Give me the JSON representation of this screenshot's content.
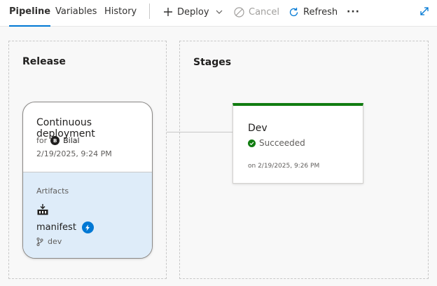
{
  "tabs": [
    {
      "label": "Pipeline",
      "active": true
    },
    {
      "label": "Variables",
      "active": false
    },
    {
      "label": "History",
      "active": false
    }
  ],
  "toolbar": {
    "deploy_label": "Deploy",
    "cancel_label": "Cancel",
    "refresh_label": "Refresh",
    "more_label": "···"
  },
  "release": {
    "section_title": "Release",
    "card_title": "Continuous deployment",
    "for_label": "for",
    "user_initial": "B",
    "user_name": "Bilal",
    "date": "2/19/2025, 9:24 PM",
    "artifacts_label": "Artifacts",
    "artifact_name": "manifest",
    "branch": "dev"
  },
  "stages": {
    "section_title": "Stages",
    "items": [
      {
        "name": "Dev",
        "status": "Succeeded",
        "date": "on 2/19/2025, 9:26 PM"
      }
    ]
  },
  "colors": {
    "accent": "#0078d4",
    "success": "#107c10",
    "artifact_bg": "#deecf9"
  }
}
